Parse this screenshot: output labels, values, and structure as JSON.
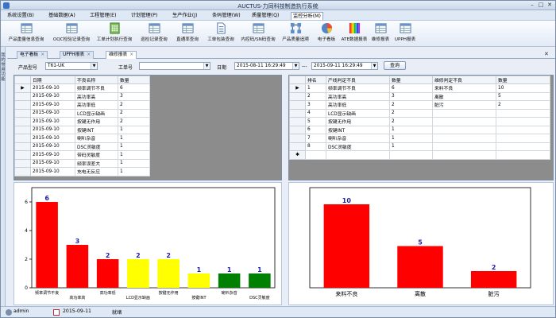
{
  "window": {
    "title": "AUCTUS-力同科技制造执行系统"
  },
  "menubar": {
    "items": [
      {
        "label": "系统设置(B)"
      },
      {
        "label": "基础数据(A)"
      },
      {
        "label": "工程管理(E)"
      },
      {
        "label": "计划管理(P)"
      },
      {
        "label": "生产作业(J)"
      },
      {
        "label": "条码管理(W)"
      },
      {
        "label": "质量管理(Q)"
      },
      {
        "label": "监控分析(M)",
        "active": true
      }
    ]
  },
  "ribbon": {
    "buttons": [
      {
        "label": "产品重量信息查询",
        "icon": "table-icon"
      },
      {
        "label": "OQC检验记录查询",
        "icon": "table-icon"
      },
      {
        "label": "工单计划执行查询",
        "icon": "calendar-icon"
      },
      {
        "label": "巡检记录查询",
        "icon": "table-icon"
      },
      {
        "label": "直通率查询",
        "icon": "table-icon"
      },
      {
        "label": "工单包装查询",
        "icon": "document-icon"
      },
      {
        "label": "内控码/SN码查询",
        "icon": "table-icon"
      },
      {
        "label": "产品质量追溯",
        "icon": "flow-icon"
      },
      {
        "label": "电子看板",
        "icon": "pie-chart-icon"
      },
      {
        "label": "ATE数据报表",
        "icon": "color-bars-icon"
      },
      {
        "label": "维修报表",
        "icon": "table-icon"
      },
      {
        "label": "UPPH报表",
        "icon": "table-icon"
      }
    ]
  },
  "sidepanel": {
    "label": "我的常用功能"
  },
  "doctabs": [
    {
      "label": "电子看板"
    },
    {
      "label": "UPPH报表"
    },
    {
      "label": "维修报表",
      "active": true
    }
  ],
  "filter": {
    "product_label": "产品型号",
    "product_value": "T61-UK",
    "workorder_label": "工单号",
    "workorder_value": "",
    "date_label": "日期",
    "date_from": "2015-08-11 16:29:49",
    "date_sep": "---",
    "date_to": "2015-09-11 16:29:49",
    "query_button": "查询"
  },
  "left_grid": {
    "headers": [
      "日期",
      "不良名称",
      "数量"
    ],
    "rows": [
      [
        "2015-09-10",
        "频率调节不良",
        "6"
      ],
      [
        "2015-09-10",
        "高功率高",
        "3"
      ],
      [
        "2015-09-10",
        "高功率低",
        "2"
      ],
      [
        "2015-09-10",
        "LCD显示缺画",
        "2"
      ],
      [
        "2015-09-10",
        "按键无作用",
        "2"
      ],
      [
        "2015-09-10",
        "按键INT",
        "1"
      ],
      [
        "2015-09-10",
        "喇叭杂音",
        "1"
      ],
      [
        "2015-09-10",
        "DSC灵敏度",
        "1"
      ],
      [
        "2015-09-10",
        "带码灵敏度",
        "1"
      ],
      [
        "2015-09-10",
        "频率误差大",
        "1"
      ],
      [
        "2015-09-10",
        "充电无反应",
        "1"
      ]
    ]
  },
  "right_grid": {
    "headers": [
      "排名",
      "产线判定不良",
      "数量",
      "维修判定不良",
      "数量"
    ],
    "rows": [
      [
        "1",
        "频率调节不良",
        "6",
        "来料不良",
        "10"
      ],
      [
        "2",
        "高功率高",
        "3",
        "离散",
        "5"
      ],
      [
        "3",
        "高功率低",
        "2",
        "脏污",
        "2"
      ],
      [
        "4",
        "LCD显示缺画",
        "2",
        "",
        ""
      ],
      [
        "5",
        "按键无作用",
        "2",
        "",
        ""
      ],
      [
        "6",
        "按键INT",
        "1",
        "",
        ""
      ],
      [
        "7",
        "喇叭杂音",
        "1",
        "",
        ""
      ],
      [
        "8",
        "DSC灵敏度",
        "1",
        "",
        ""
      ]
    ]
  },
  "chart_data": [
    {
      "type": "bar",
      "categories": [
        "频率调节不良",
        "高功率高",
        "高功率低",
        "LCD显示缺画",
        "按键无作用",
        "按键INT",
        "喇叭杂音",
        "DSC灵敏度"
      ],
      "values": [
        6,
        3,
        2,
        2,
        2,
        1,
        1,
        1
      ],
      "colors": [
        "#ff0000",
        "#ff0000",
        "#ff0000",
        "#ffff00",
        "#ffff00",
        "#ffff00",
        "#008000",
        "#008000"
      ],
      "ylim": [
        0,
        7
      ],
      "yticks": [
        0,
        2,
        4,
        6
      ],
      "grid": false,
      "title": "",
      "xlabel": "",
      "ylabel": ""
    },
    {
      "type": "bar",
      "categories": [
        "来料不良",
        "离散",
        "脏污"
      ],
      "values": [
        10,
        5,
        2
      ],
      "colors": [
        "#ff0000",
        "#ff0000",
        "#ff0000"
      ],
      "ylim": [
        0,
        12
      ],
      "yticks": [],
      "grid": false,
      "title": "",
      "xlabel": "",
      "ylabel": ""
    }
  ],
  "statusbar": {
    "user": "admin",
    "date": "2015-09-11",
    "status": "就绪"
  }
}
